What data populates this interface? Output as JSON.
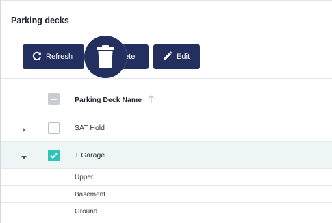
{
  "panel": {
    "title": "Parking decks"
  },
  "toolbar": {
    "refresh_label": "Refresh",
    "delete_label": "ete",
    "edit_label": "Edit"
  },
  "table": {
    "column_header": "Parking Deck Name",
    "rows": [
      {
        "name": "SAT Hold",
        "expanded": false,
        "checked": false
      },
      {
        "name": "T Garage",
        "expanded": true,
        "checked": true,
        "children": [
          "Upper",
          "Basement",
          "Ground"
        ]
      }
    ]
  },
  "colors": {
    "button_bg": "#232f5f",
    "checkbox_checked": "#2fc4b8",
    "selected_row_bg": "#eef6f5"
  }
}
